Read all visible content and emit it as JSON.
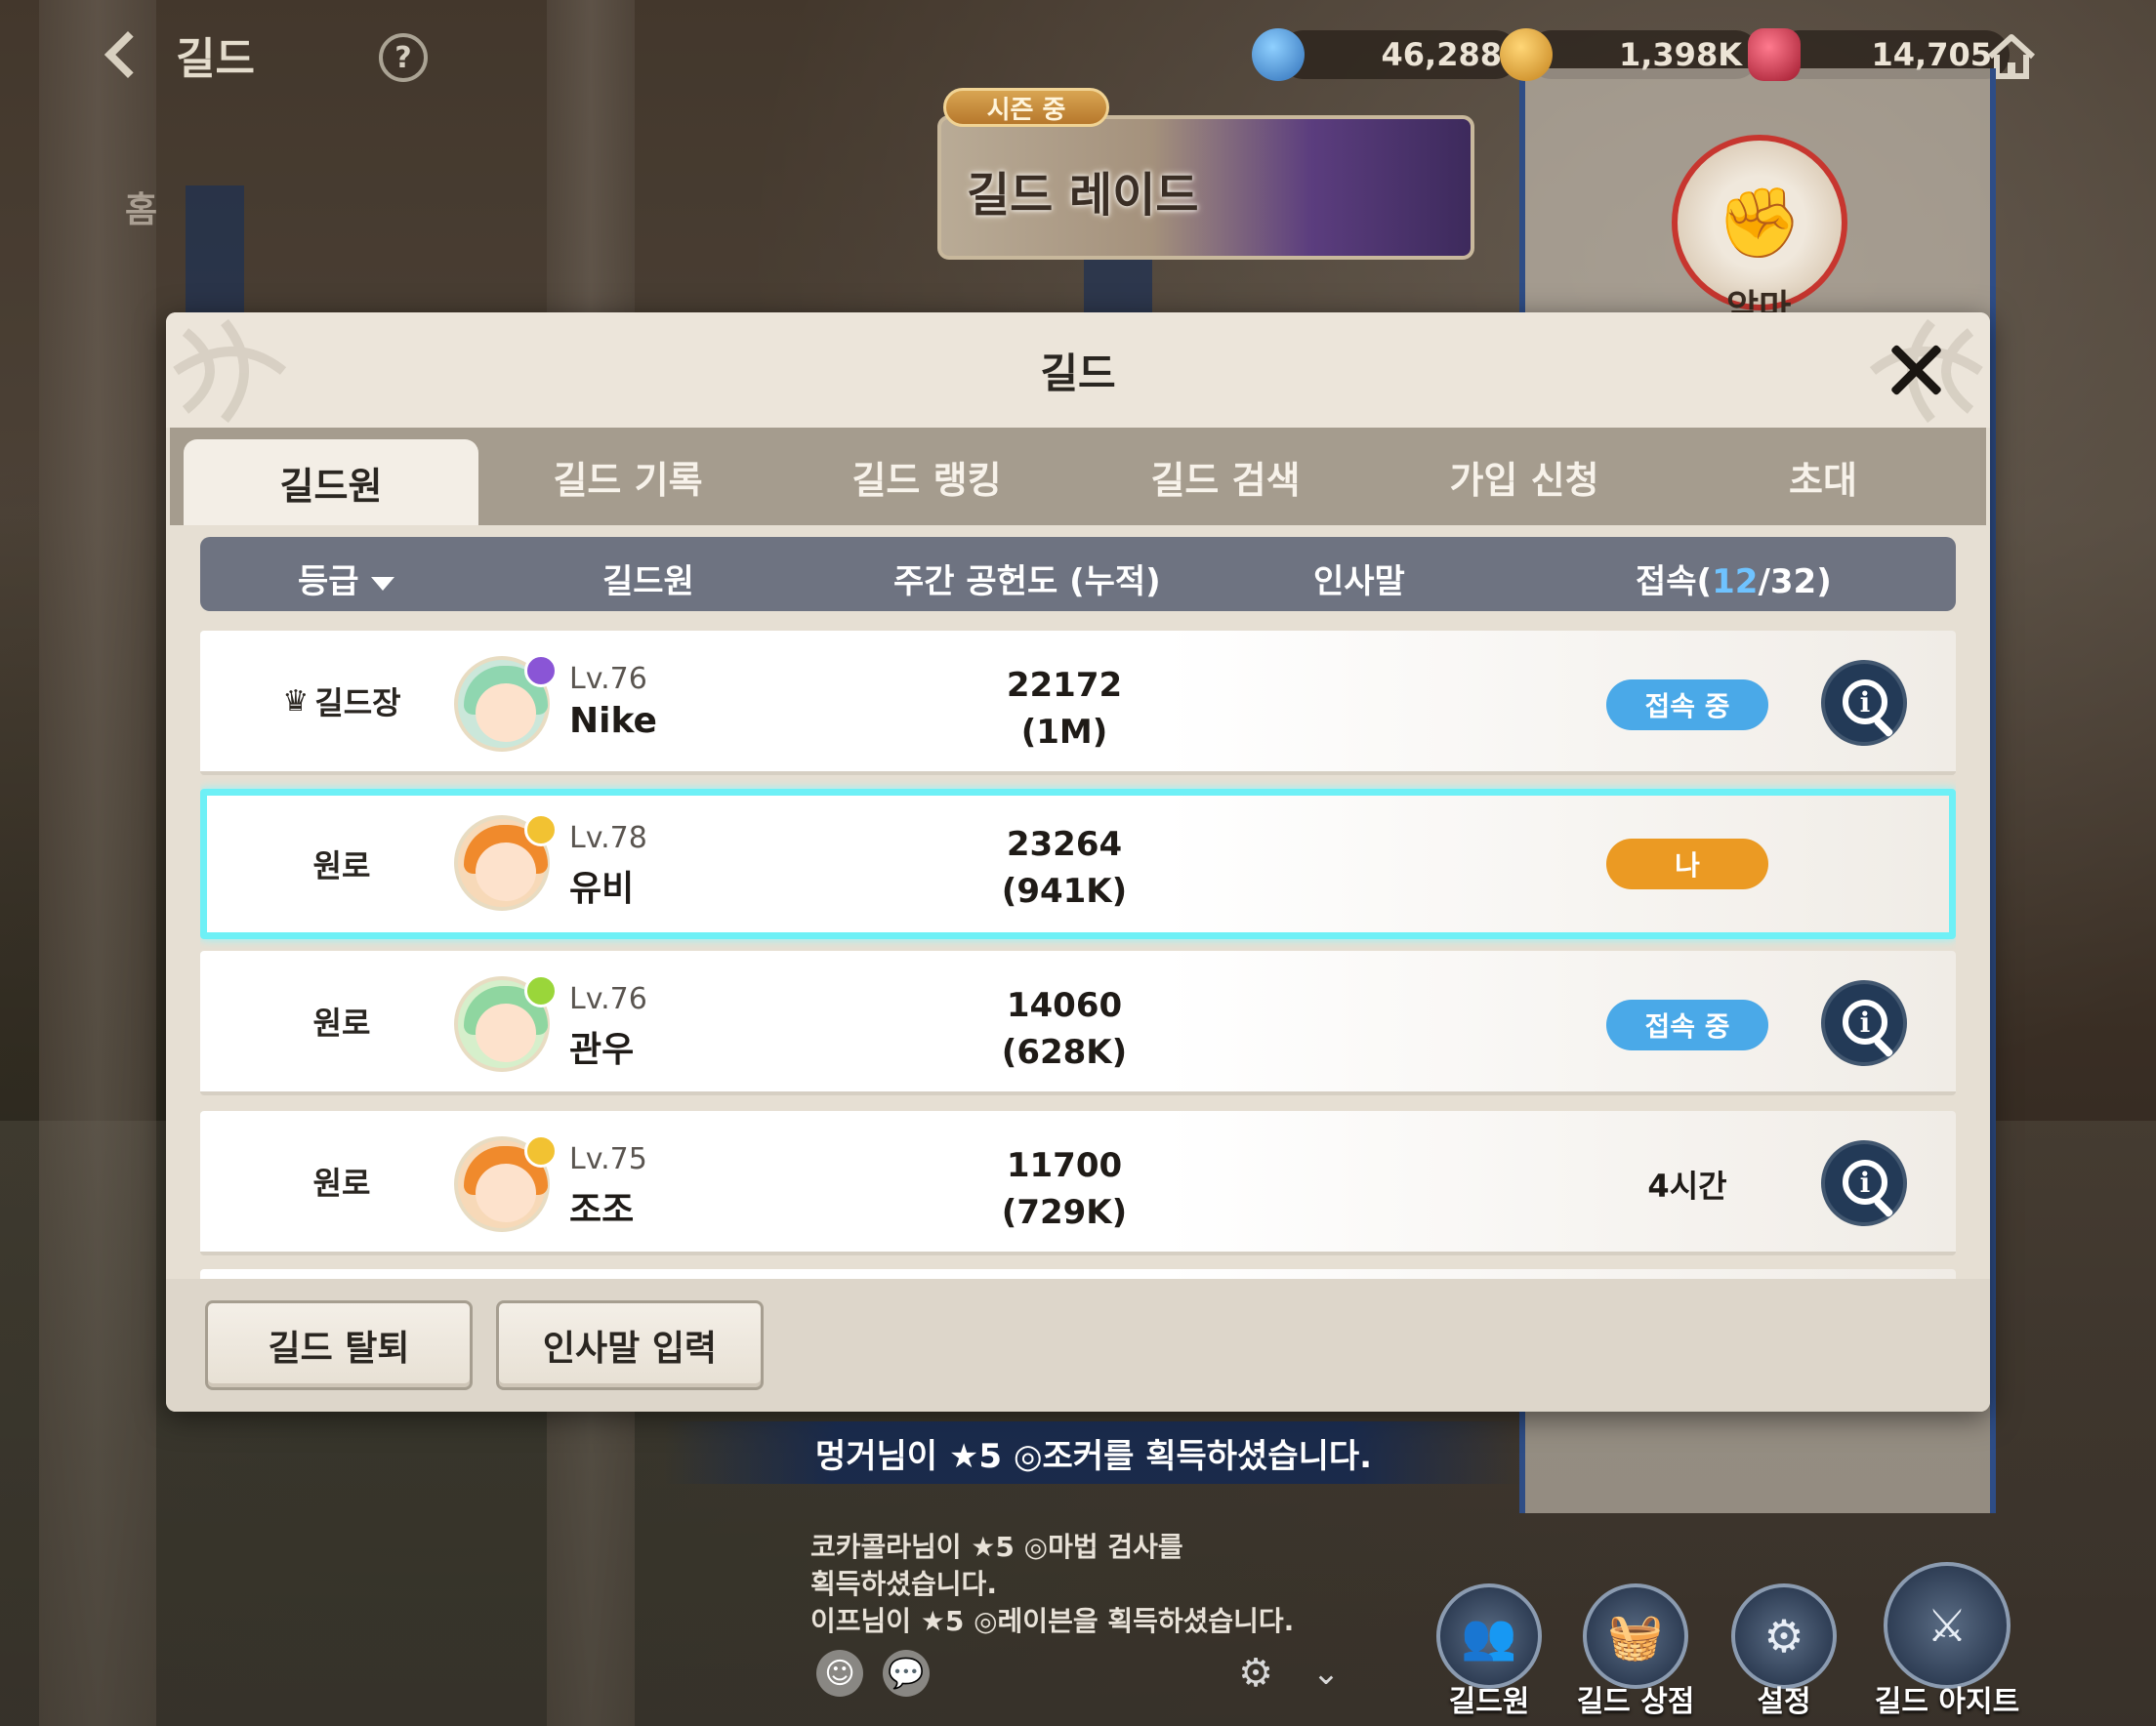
{
  "topbar": {
    "back_title": "길드",
    "help_symbol": "?",
    "currencies": [
      {
        "icon": "blue-gem-icon",
        "value": "46,288",
        "color": "#4a86c9"
      },
      {
        "icon": "gold-coin-icon",
        "value": "1,398K",
        "color": "#e3a02a"
      },
      {
        "icon": "red-crystal-icon",
        "value": "14,705",
        "color": "#c7283f"
      }
    ]
  },
  "background": {
    "raid_tag": "시즌 중",
    "raid_title": "길드 레이드",
    "emblem_label": "악마",
    "side_labels": [
      "홈"
    ]
  },
  "modal": {
    "title": "길드",
    "tabs": [
      "길드원",
      "길드 기록",
      "길드 랭킹",
      "길드 검색",
      "가입 신청",
      "초대"
    ],
    "columns": {
      "rank": "등급",
      "member": "길드원",
      "contribution": "주간 공헌도 (누적)",
      "greeting": "인사말",
      "online_prefix": "접속(",
      "online_count": "12",
      "online_sep": "/",
      "online_total": "32",
      "online_suffix": ")"
    },
    "members": [
      {
        "rank": "길드장",
        "level": "Lv.76",
        "name": "Nike",
        "weekly": "22172",
        "total": "(1M)",
        "status": "접속 중",
        "hair": "#8fd6b0",
        "badge": "#8a55d6"
      },
      {
        "rank": "원로",
        "level": "Lv.78",
        "name": "유비",
        "weekly": "23264",
        "total": "(941K)",
        "status": "나",
        "hair": "#f08a2c",
        "badge": "#f2c232"
      },
      {
        "rank": "원로",
        "level": "Lv.76",
        "name": "관우",
        "weekly": "14060",
        "total": "(628K)",
        "status": "접속 중",
        "hair": "#8fd6a0",
        "badge": "#9ad63a"
      },
      {
        "rank": "원로",
        "level": "Lv.75",
        "name": "조조",
        "weekly": "11700",
        "total": "(729K)",
        "status": "4시간",
        "hair": "#f08a2c",
        "badge": "#f2c232"
      }
    ],
    "footer": {
      "leave": "길드 탈퇴",
      "greeting_input": "인사말 입력"
    }
  },
  "notice": "멍거님이 ★5 ◎조커를 획득하셨습니다.",
  "chat": [
    "코카콜라님이 ★5 ◎마법 검사를",
    "획득하셨습니다.",
    "이프님이 ★5 ◎레이븐을 획득하셨습니다."
  ],
  "bottom_nav": [
    {
      "icon": "guild-members-icon",
      "label": "길드원"
    },
    {
      "icon": "guild-shop-icon",
      "label": "길드 상점"
    },
    {
      "icon": "settings-icon",
      "label": "설정"
    },
    {
      "icon": "guild-hideout-icon",
      "label": "길드 아지트"
    }
  ]
}
